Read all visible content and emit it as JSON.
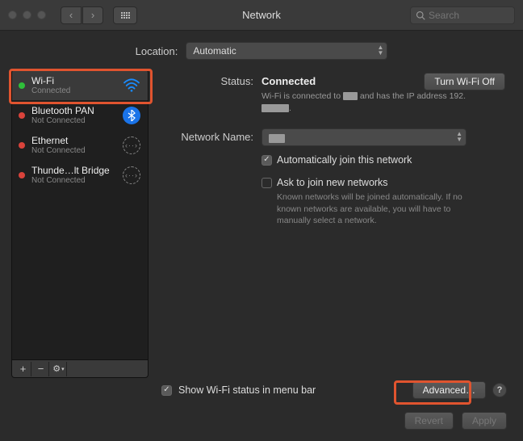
{
  "window": {
    "title": "Network"
  },
  "search": {
    "placeholder": "Search"
  },
  "location": {
    "label": "Location:",
    "value": "Automatic"
  },
  "sidebar": {
    "items": [
      {
        "name": "Wi-Fi",
        "sub": "Connected",
        "status": "green",
        "icon": "wifi",
        "selected": true
      },
      {
        "name": "Bluetooth PAN",
        "sub": "Not Connected",
        "status": "red",
        "icon": "bluetooth"
      },
      {
        "name": "Ethernet",
        "sub": "Not Connected",
        "status": "red",
        "icon": "ethernet"
      },
      {
        "name": "Thunde…lt Bridge",
        "sub": "Not Connected",
        "status": "red",
        "icon": "ethernet"
      }
    ]
  },
  "main": {
    "status_label": "Status:",
    "status_value": "Connected",
    "wifi_off_btn": "Turn Wi-Fi Off",
    "status_desc_pre": "Wi-Fi is connected to ",
    "status_desc_mid": " and has the IP address 192.",
    "status_desc_post": ".",
    "netname_label": "Network Name:",
    "netname_value": "",
    "auto_join": "Automatically join this network",
    "ask_join": "Ask to join new networks",
    "ask_desc": "Known networks will be joined automatically. If no known networks are available, you will have to manually select a network."
  },
  "bottom": {
    "show_status": "Show Wi-Fi status in menu bar",
    "advanced": "Advanced…"
  },
  "footer": {
    "revert": "Revert",
    "apply": "Apply"
  }
}
